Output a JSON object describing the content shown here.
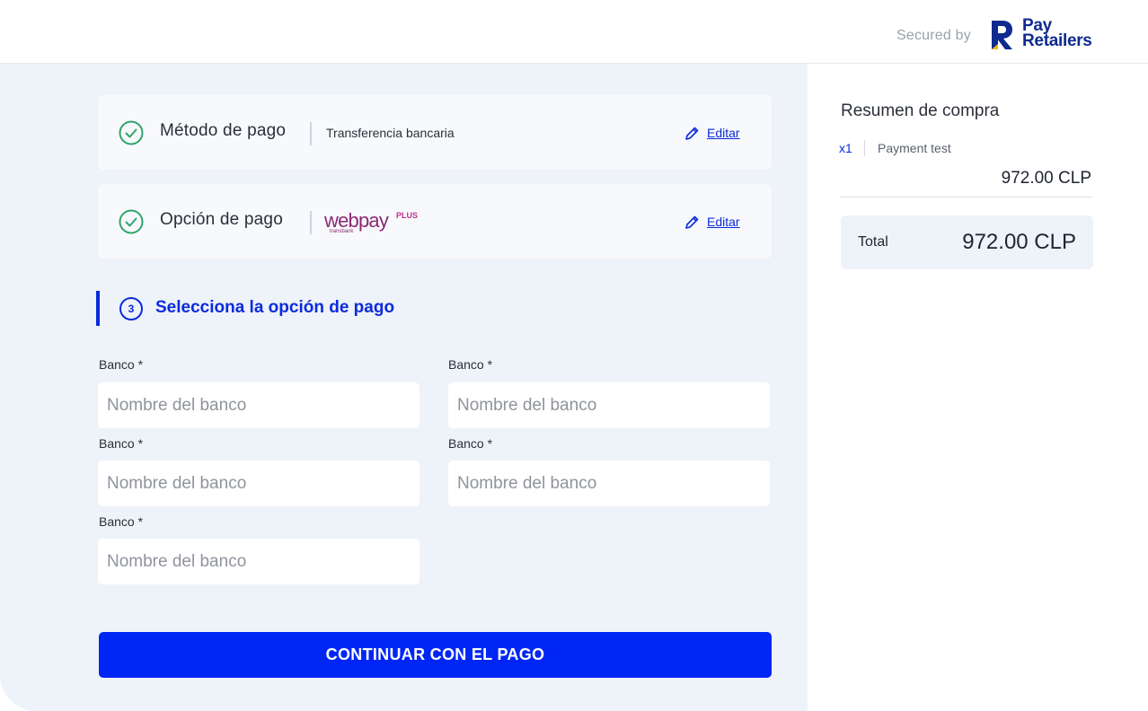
{
  "header": {
    "secured_by": "Secured by",
    "brand_line1": "Pay",
    "brand_line2": "Retailers",
    "brand_color": "#0f2a8f",
    "brand_accent": "#f5b800"
  },
  "steps": {
    "payment_method": {
      "title": "Método de pago",
      "value": "Transferencia bancaria",
      "edit_label": "Editar",
      "status_icon": "check-circle-icon"
    },
    "payment_option": {
      "title": "Opción de pago",
      "logo_main": "webpay",
      "logo_plus": "PLUS",
      "logo_sub": "transbank",
      "edit_label": "Editar",
      "status_icon": "check-circle-icon"
    },
    "current": {
      "number": "3",
      "title": "Selecciona la opción de pago"
    }
  },
  "form": {
    "fields": [
      {
        "label": "Banco *",
        "placeholder": "Nombre del banco",
        "value": ""
      },
      {
        "label": "Banco *",
        "placeholder": "Nombre del banco",
        "value": ""
      },
      {
        "label": "Banco *",
        "placeholder": "Nombre del banco",
        "value": ""
      },
      {
        "label": "Banco *",
        "placeholder": "Nombre del banco",
        "value": ""
      },
      {
        "label": "Banco *",
        "placeholder": "Nombre del banco",
        "value": ""
      }
    ],
    "submit_label": "CONTINUAR CON EL PAGO"
  },
  "summary": {
    "title": "Resumen de compra",
    "items": [
      {
        "qty": "x1",
        "name": "Payment test",
        "price": "972.00 CLP"
      }
    ],
    "total_label": "Total",
    "total_value": "972.00 CLP"
  },
  "colors": {
    "accent": "#0a2bdc",
    "cta": "#0026f5",
    "success": "#2fa56b",
    "page_bg": "#eef2f9"
  }
}
